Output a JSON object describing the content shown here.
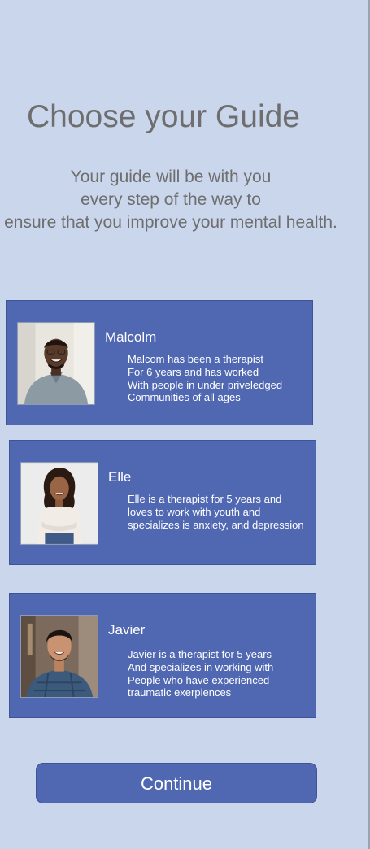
{
  "header": {
    "title": "Choose your Guide",
    "subtitle_lines": [
      "Your guide will be with you",
      "every step of the way to",
      "ensure that you improve your mental health."
    ]
  },
  "guides": [
    {
      "name": "Malcolm",
      "description_lines": [
        "Malcom has been a therapist",
        "For 6 years and has worked",
        "With people in under priveledged",
        "Communities of all ages"
      ]
    },
    {
      "name": "Elle",
      "description_lines": [
        "Elle is a therapist for 5 years and",
        "loves to work with youth and",
        "specializes is anxiety, and depression"
      ]
    },
    {
      "name": "Javier",
      "description_lines": [
        "Javier is a therapist for 5 years",
        "And specializes in working with",
        "People who have experienced",
        "traumatic exerpiences"
      ]
    }
  ],
  "footer": {
    "continue_label": "Continue"
  },
  "colors": {
    "background": "#cad6ec",
    "card": "#5068b2",
    "heading_text": "#6e6e6e",
    "card_text": "#ffffff"
  }
}
